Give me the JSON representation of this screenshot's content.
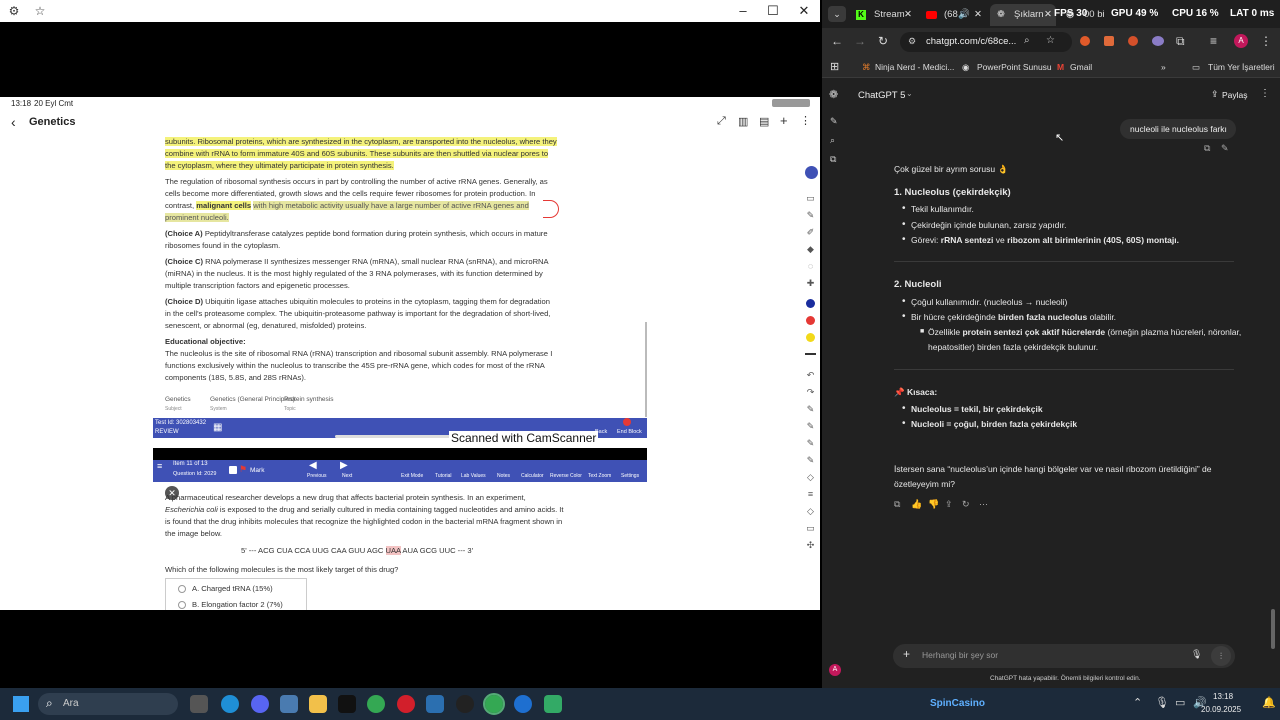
{
  "left_window": {
    "title": "Genetics",
    "status_time": "13:18",
    "status_date": "20 Eyl Cmt"
  },
  "document": {
    "p1": "subunits.  Ribosomal proteins, which are synthesized in the cytoplasm, are transported into the nucleolus, where they combine with rRNA to form immature 40S and 60S subunits.  These subunits are then shuttled via nuclear pores to the cytoplasm, where they ultimately participate in protein synthesis.",
    "p2a": "The regulation of ribosomal synthesis occurs in part by controlling the number of active rRNA genes.  Generally, as cells become more differentiated, growth slows and the cells require fewer ribosomes for protein production. In contrast,",
    "p2b": "malignant cells",
    "p2c": "with high metabolic activity usually have a large number of active rRNA genes and prominent nucleoli.",
    "choice_a_label": "(Choice A)",
    "choice_a": "Peptidyltransferase catalyzes peptide bond formation during protein synthesis, which occurs in mature ribosomes found in the cytoplasm.",
    "choice_c_label": "(Choice C)",
    "choice_c": "RNA polymerase II synthesizes messenger RNA (mRNA), small nuclear RNA (snRNA), and microRNA (miRNA) in the nucleus.  It is the most highly regulated of the 3 RNA polymerases, with its function determined by multiple transcription factors and epigenetic processes.",
    "choice_d_label": "(Choice D)",
    "choice_d": "Ubiquitin ligase attaches ubiquitin molecules to proteins in the cytoplasm, tagging them for degradation in the cell's proteasome complex.  The ubiquitin-proteasome pathway is important for the degradation of short-lived, senescent, or abnormal (eg, denatured, misfolded) proteins.",
    "edu_title": "Educational objective:",
    "edu_text": "The nucleolus is the site of ribosomal RNA (rRNA) transcription and ribosomal subunit assembly.  RNA polymerase I functions exclusively within the nucleolus to transcribe the 45S pre-rRNA gene, which codes for most of the rRNA components (18S, 5.8S, and 28S rRNAs).",
    "tags": [
      {
        "v": "Genetics",
        "k": "Subject"
      },
      {
        "v": "Genetics (General Principles)",
        "k": "System"
      },
      {
        "v": "Protein synthesis",
        "k": "Topic"
      }
    ],
    "test_id": "Test Id: 302803432",
    "review": "REVIEW",
    "footer_btns": [
      "Back",
      "End Block"
    ],
    "cam": "Scanned with CamScanner",
    "item": "Item 11 of 13",
    "question_id": "Question Id: 2029",
    "mark": "Mark",
    "nav": [
      "Previous",
      "Next"
    ],
    "tools": [
      "Exit Mode",
      "Tutorial",
      "Lab Values",
      "Notes",
      "Calculator",
      "Reverse Color",
      "Text Zoom",
      "Settings"
    ],
    "q_text_1": "A pharmaceutical researcher develops a new drug that affects bacterial protein synthesis.  In an experiment,",
    "q_text_2a": "Escherichia coli",
    "q_text_2b": "is exposed to the drug and serially cultured in media containing tagged nucleotides and amino acids.  It is found that the drug inhibits molecules that recognize the highlighted codon in the bacterial mRNA fragment shown in the image below.",
    "seq_a": "5' --- ACG CUA CCA UUG CAA GUU AGC ",
    "seq_b": "UAA",
    "seq_c": " AUA GCG UUC --- 3'",
    "q_prompt": "Which of the following molecules is the most likely target of this drug?",
    "options": [
      "A.  Charged tRNA (15%)",
      "B.  Elongation factor 2 (7%)"
    ]
  },
  "browser": {
    "tabs": [
      "Stream",
      "(68",
      "Şıklarn",
      "00 bi"
    ],
    "overlay": {
      "fps": "FPS 30",
      "gpu": "GPU 49 %",
      "cpu": "CPU 16 %",
      "lat": "LAT 0 ms"
    },
    "url": "chatgpt.com/c/68ce...",
    "bookmarks": [
      "Ninja Nerd - Medici...",
      "PowerPoint Sunusu",
      "Gmail"
    ],
    "all_bookmarks": "Tüm Yer İşaretleri",
    "model": "ChatGPT 5",
    "share": "Paylaş",
    "user_msg": "nucleoli ile nucleolus farkı",
    "intro": "Çok güzel bir ayrım sorusu 👌",
    "h1": "1. Nucleolus (çekirdekçik)",
    "b1": "Tekil kullanımdır.",
    "b2": "Çekirdeğin içinde bulunan, zarsız yapıdır.",
    "b3a": "Görevi: ",
    "b3b": "rRNA sentezi",
    "b3c": " ve ",
    "b3d": "ribozom alt birimlerinin (40S, 60S) montajı.",
    "h2": "2. Nucleoli",
    "c1": "Çoğul kullanımıdır. (nucleolus → nucleoli)",
    "c2a": "Bir hücre çekirdeğinde ",
    "c2b": "birden fazla nucleolus",
    "c2c": " olabilir.",
    "c3a": "Özellikle ",
    "c3b": "protein sentezi çok aktif hücrelerde",
    "c3c": " (örneğin plazma hücreleri, nöronlar,",
    "c3d": "hepatositler) birden fazla çekirdekçik bulunur.",
    "sum_title": "📌 Kısaca:",
    "s1": "Nucleolus = tekil, bir çekirdekçik",
    "s2": "Nucleoli = çoğul, birden fazla çekirdekçik",
    "followup1": "İstersen sana “nucleolus’un içinde hangi bölgeler var ve nasıl ribozom üretildiğini” de",
    "followup2": "özetleyeyim mi?",
    "placeholder": "Herhangi bir şey sor",
    "disclaimer": "ChatGPT hata yapabilir. Önemli bilgileri kontrol edin.",
    "avatar": "A"
  },
  "taskbar": {
    "search": "Ara",
    "time": "13:18",
    "date": "20.09.2025",
    "promo": "SpinCasino"
  }
}
